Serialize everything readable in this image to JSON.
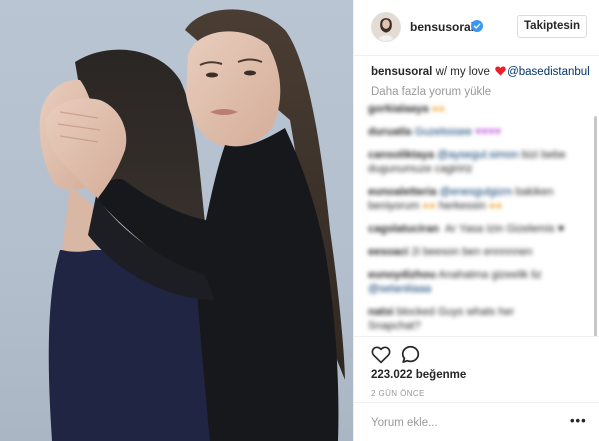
{
  "post": {
    "username": "bensusoral",
    "verified_icon": "verified-badge-icon",
    "follow_label": "Takiptesin",
    "caption_username": "bensusoral",
    "caption_text": "w/ my love",
    "caption_heart": "red-heart-emoji",
    "caption_mention": "@basedistanbul",
    "load_more": "Daha fazla yorum yükle",
    "likes": "223.022 beğenme",
    "time": "2 GÜN ÖNCE",
    "comment_placeholder": "Yorum ekle...",
    "more_label": "•••"
  },
  "colors": {
    "mention": "#003569",
    "verified": "#3897f0",
    "heart": "#ed4956",
    "muted": "#999999"
  }
}
